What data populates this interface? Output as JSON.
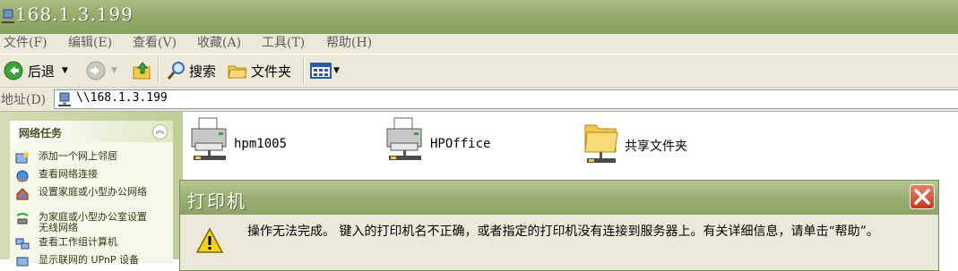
{
  "window": {
    "title": "168.1.3.199"
  },
  "menu": [
    "文件(F)",
    "编辑(E)",
    "查看(V)",
    "收藏(A)",
    "工具(T)",
    "帮助(H)"
  ],
  "toolbar": {
    "back_label": "后退",
    "search_label": "搜索",
    "folders_label": "文件夹"
  },
  "address": {
    "label": "地址(D)",
    "value": "\\\\168.1.3.199"
  },
  "sidebar": {
    "header": "网络任务",
    "collapse_glyph": "︽",
    "tasks": [
      {
        "label": "添加一个网上邻居",
        "icon": "add-network-place-icon"
      },
      {
        "label": "查看网络连接",
        "icon": "network-connections-icon"
      },
      {
        "label": "设置家庭或小型办公网络",
        "icon": "home-network-setup-icon"
      },
      {
        "label": "为家庭或小型办公室设置无线网络",
        "icon": "wireless-setup-icon"
      },
      {
        "label": "查看工作组计算机",
        "icon": "workgroup-computers-icon"
      },
      {
        "label": "显示联网的 UPnP 设备",
        "icon": "upnp-devices-icon"
      }
    ]
  },
  "items": [
    {
      "label": "hpm1005",
      "icon": "printer-icon"
    },
    {
      "label": "HPOffice",
      "icon": "printer-icon"
    },
    {
      "label": "共享文件夹",
      "icon": "shared-folder-icon"
    }
  ],
  "dialog": {
    "title": "打印机",
    "message": "操作无法完成。 键入的打印机名不正确，或者指定的打印机没有连接到服务器上。有关详细信息，请单击“帮助”。"
  },
  "colors": {
    "titlebar": "#93ab6a",
    "chrome": "#ece9d8",
    "close": "#c9381d"
  }
}
